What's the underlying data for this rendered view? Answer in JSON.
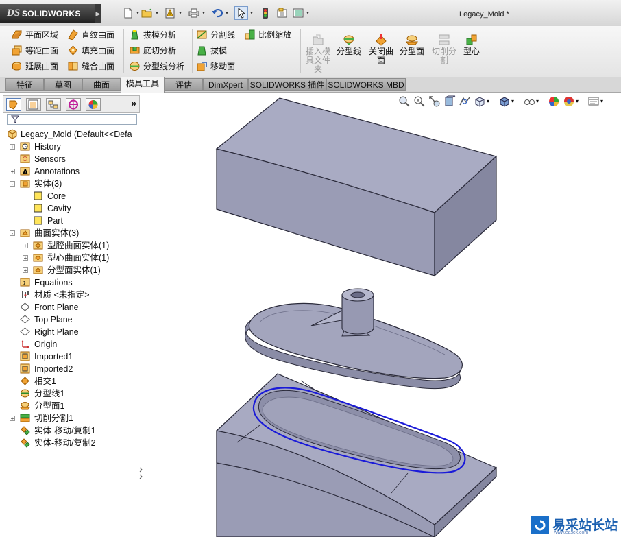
{
  "app": {
    "logo_ds": "DS",
    "logo_text": "SOLIDWORKS",
    "document_title": "Legacy_Mold *"
  },
  "quick_access": [
    "new-icon",
    "open-icon",
    "rebuild-icon",
    "print-icon",
    "undo-icon",
    "select-icon",
    "traffic-light-icon",
    "file-properties-icon",
    "options-icon"
  ],
  "ribbon": {
    "col1": [
      "平面区域",
      "等距曲面",
      "延展曲面"
    ],
    "col2": [
      "直纹曲面",
      "填充曲面",
      "缝合曲面"
    ],
    "col3": [
      "拔模分析",
      "底切分析",
      "分型线分析"
    ],
    "col4": [
      "分割线",
      "拔模",
      "移动面"
    ],
    "col5": [
      "比例缩放"
    ],
    "large": [
      {
        "label": "插入模\n具文件\n夹",
        "enabled": false
      },
      {
        "label": "分型线",
        "enabled": true
      },
      {
        "label": "关闭曲\n面",
        "enabled": true
      },
      {
        "label": "分型面",
        "enabled": true
      },
      {
        "label": "切削分\n割",
        "enabled": false
      },
      {
        "label": "型心",
        "enabled": true
      }
    ]
  },
  "tabs": [
    "特征",
    "草图",
    "曲面",
    "模具工具",
    "评估",
    "DimXpert",
    "SOLIDWORKS 插件",
    "SOLIDWORKS MBD"
  ],
  "active_tab": "模具工具",
  "panel_collapse": "»",
  "tree": {
    "root": "Legacy_Mold  (Default<<Defa",
    "items": [
      {
        "label": "History",
        "level": 1,
        "expander": "+",
        "icon": "history-icon"
      },
      {
        "label": "Sensors",
        "level": 1,
        "expander": "",
        "icon": "sensor-icon"
      },
      {
        "label": "Annotations",
        "level": 1,
        "expander": "+",
        "icon": "annotations-icon"
      },
      {
        "label": "实体(3)",
        "level": 1,
        "expander": "-",
        "icon": "solid-bodies-folder-icon"
      },
      {
        "label": "Core",
        "level": 2,
        "expander": "",
        "icon": "solid-body-icon"
      },
      {
        "label": "Cavity",
        "level": 2,
        "expander": "",
        "icon": "solid-body-icon"
      },
      {
        "label": "Part",
        "level": 2,
        "expander": "",
        "icon": "solid-body-icon"
      },
      {
        "label": "曲面实体(3)",
        "level": 1,
        "expander": "-",
        "icon": "surface-bodies-folder-icon"
      },
      {
        "label": "型腔曲面实体(1)",
        "level": 2,
        "expander": "+",
        "icon": "surface-body-folder-icon"
      },
      {
        "label": "型心曲面实体(1)",
        "level": 2,
        "expander": "+",
        "icon": "surface-body-folder-icon"
      },
      {
        "label": "分型面实体(1)",
        "level": 2,
        "expander": "+",
        "icon": "surface-body-folder-icon"
      },
      {
        "label": "Equations",
        "level": 1,
        "expander": "",
        "icon": "equations-icon"
      },
      {
        "label": "材质 <未指定>",
        "level": 1,
        "expander": "",
        "icon": "material-icon"
      },
      {
        "label": "Front Plane",
        "level": 1,
        "expander": "",
        "icon": "plane-icon"
      },
      {
        "label": "Top Plane",
        "level": 1,
        "expander": "",
        "icon": "plane-icon"
      },
      {
        "label": "Right Plane",
        "level": 1,
        "expander": "",
        "icon": "plane-icon"
      },
      {
        "label": "Origin",
        "level": 1,
        "expander": "",
        "icon": "origin-icon"
      },
      {
        "label": "Imported1",
        "level": 1,
        "expander": "",
        "icon": "imported-feature-icon"
      },
      {
        "label": "Imported2",
        "level": 1,
        "expander": "",
        "icon": "imported-feature-icon"
      },
      {
        "label": "相交1",
        "level": 1,
        "expander": "",
        "icon": "intersect-icon"
      },
      {
        "label": "分型线1",
        "level": 1,
        "expander": "",
        "icon": "parting-line-icon"
      },
      {
        "label": "分型面1",
        "level": 1,
        "expander": "",
        "icon": "parting-surface-icon"
      },
      {
        "label": "切削分割1",
        "level": 1,
        "expander": "+",
        "icon": "tooling-split-icon"
      },
      {
        "label": "实体-移动/复制1",
        "level": 1,
        "expander": "",
        "icon": "move-copy-body-icon"
      },
      {
        "label": "实体-移动/复制2",
        "level": 1,
        "expander": "",
        "icon": "move-copy-body-icon"
      }
    ]
  },
  "view_toolbar": [
    "zoom-to-fit-icon",
    "zoom-to-area-icon",
    "previous-view-icon",
    "section-view-icon",
    "dynamic-annotation-icon",
    "view-orientation-icon",
    "display-style-icon",
    "hide-show-items-icon",
    "edit-appearance-icon",
    "apply-scene-icon",
    "view-settings-icon"
  ],
  "watermark": {
    "text": "易采站长站",
    "sub": "www.easck.com"
  },
  "colors": {
    "model": "#9a9cb4",
    "model_top": "#a8aac2",
    "model_dark": "#7d8098",
    "parting_line": "#1a1ad8"
  }
}
